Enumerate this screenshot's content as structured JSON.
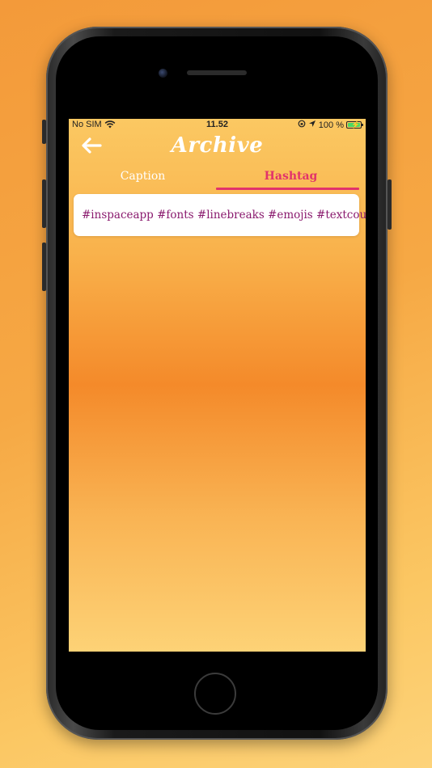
{
  "status_bar": {
    "carrier": "No SIM",
    "time": "11.52",
    "battery": "100 %",
    "battery_level": 1.0,
    "icons": [
      "wifi-icon",
      "orientation-lock-icon",
      "location-arrow-icon",
      "battery-charging-icon"
    ]
  },
  "header": {
    "title": "Archive",
    "back_icon": "arrow-left-icon"
  },
  "tabs": [
    {
      "label": "Caption",
      "selected": false
    },
    {
      "label": "Hashtag",
      "selected": true
    }
  ],
  "archive_items": [
    {
      "text": "#inspaceapp #fonts #linebreaks #emojis #textcounter"
    }
  ],
  "colors": {
    "accent": "#e2336b",
    "hashtag_text": "#8a1a6e",
    "title": "#ffffff"
  }
}
